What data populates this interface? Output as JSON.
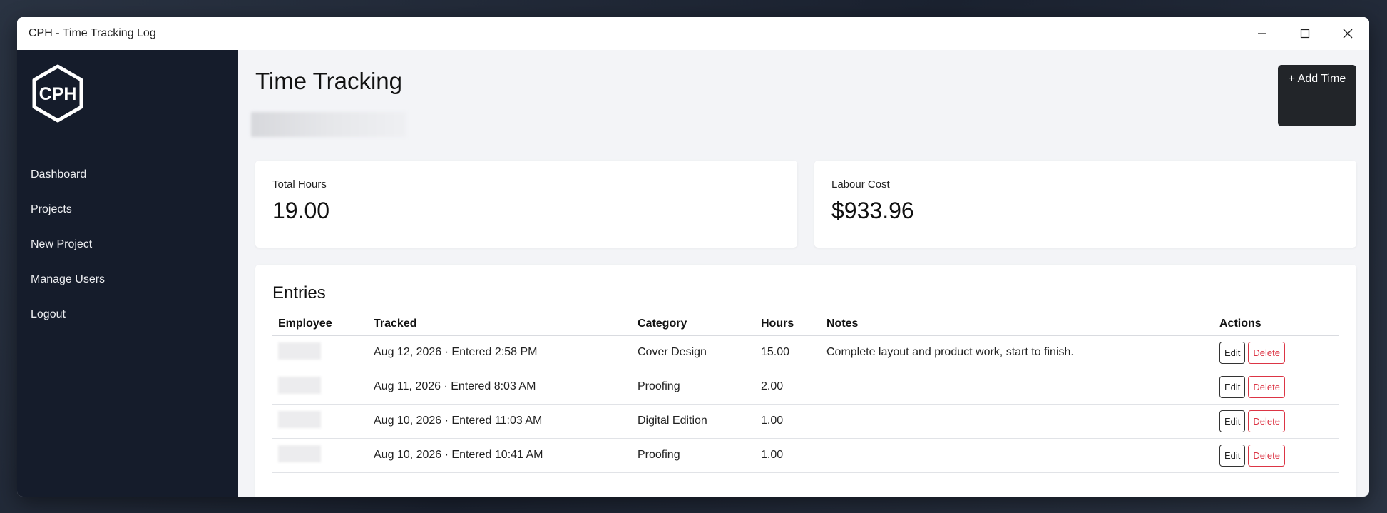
{
  "window": {
    "title": "CPH - Time Tracking Log"
  },
  "sidebar": {
    "logo_text": "CPH",
    "items": [
      {
        "label": "Dashboard"
      },
      {
        "label": "Projects"
      },
      {
        "label": "New Project"
      },
      {
        "label": "Manage Users"
      },
      {
        "label": "Logout"
      }
    ]
  },
  "header": {
    "title": "Time Tracking",
    "add_button": "+ Add Time"
  },
  "stats": {
    "total_hours": {
      "label": "Total Hours",
      "value": "19.00"
    },
    "labour_cost": {
      "label": "Labour Cost",
      "value": "$933.96"
    }
  },
  "entries": {
    "title": "Entries",
    "columns": [
      "Employee",
      "Tracked",
      "Category",
      "Hours",
      "Notes",
      "Actions"
    ],
    "rows": [
      {
        "tracked": "Aug 12, 2026 · Entered 2:58 PM",
        "category": "Cover Design",
        "hours": "15.00",
        "notes": "Complete layout and product work, start to finish."
      },
      {
        "tracked": "Aug 11, 2026 · Entered 8:03 AM",
        "category": "Proofing",
        "hours": "2.00",
        "notes": ""
      },
      {
        "tracked": "Aug 10, 2026 · Entered 11:03 AM",
        "category": "Digital Edition",
        "hours": "1.00",
        "notes": ""
      },
      {
        "tracked": "Aug 10, 2026 · Entered 10:41 AM",
        "category": "Proofing",
        "hours": "1.00",
        "notes": ""
      }
    ],
    "edit_label": "Edit",
    "delete_label": "Delete"
  },
  "colors": {
    "sidebar_bg": "#151c2b",
    "delete_red": "#dc3545",
    "add_button_bg": "#222529"
  }
}
